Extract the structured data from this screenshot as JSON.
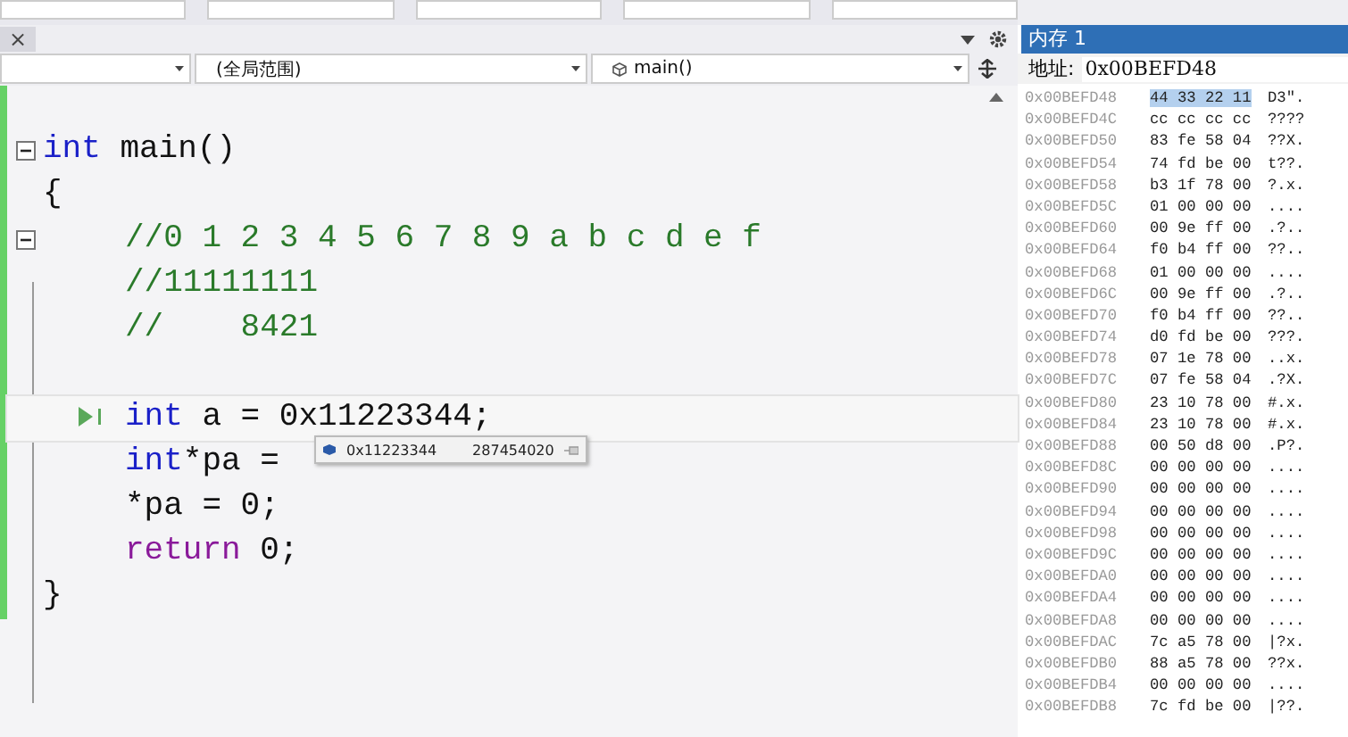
{
  "toolbar": {
    "fields": [
      {
        "kind": "field"
      },
      {
        "kind": "field"
      },
      {
        "kind": "field"
      },
      {
        "kind": "field"
      },
      {
        "kind": "field"
      }
    ]
  },
  "editor": {
    "close_glyph": "×",
    "combos": [
      {
        "icon": false
      },
      {
        "text": "(全局范围)",
        "icon": false
      },
      {
        "text": "main()",
        "icon": true
      }
    ],
    "lines": [
      {
        "fold_marker": true,
        "current": false,
        "indented": false,
        "tokens": [
          {
            "text": "int",
            "kind": "keyword"
          },
          {
            "text": " main()",
            "kind": "plain"
          }
        ]
      },
      {
        "fold_marker": false,
        "current": false,
        "indented": false,
        "tokens": [
          {
            "text": "{",
            "kind": "plain"
          }
        ]
      },
      {
        "fold_marker": true,
        "current": false,
        "indented": true,
        "tokens": [
          {
            "text": "//0 1 2 3 4 5 6 7 8 9 a b c d e f",
            "kind": "comment"
          }
        ]
      },
      {
        "fold_marker": false,
        "current": false,
        "indented": true,
        "tokens": [
          {
            "text": "//11111111",
            "kind": "comment"
          }
        ]
      },
      {
        "fold_marker": false,
        "current": false,
        "indented": true,
        "tokens": [
          {
            "text": "//    8421",
            "kind": "comment"
          }
        ]
      },
      {
        "fold_marker": false,
        "current": false
      },
      {
        "fold_marker": false,
        "current": true,
        "indented": true,
        "tokens": [
          {
            "text": "int",
            "kind": "keyword"
          },
          {
            "text": " a = 0x11223344;",
            "kind": "plain"
          }
        ]
      },
      {
        "fold_marker": false,
        "current": false,
        "indented": true,
        "tokens": [
          {
            "text": "int",
            "kind": "keyword"
          },
          {
            "text": "*pa =",
            "kind": "plain"
          }
        ]
      },
      {
        "fold_marker": false,
        "current": false,
        "indented": true,
        "tokens": [
          {
            "text": "*pa = 0;",
            "kind": "plain"
          }
        ]
      },
      {
        "fold_marker": false,
        "current": false,
        "indented": true,
        "tokens": [
          {
            "text": "return",
            "kind": "control"
          },
          {
            "text": " 0;",
            "kind": "plain"
          }
        ]
      },
      {
        "fold_marker": false,
        "current": false,
        "indented": false,
        "tokens": [
          {
            "text": "}",
            "kind": "plain"
          }
        ]
      }
    ],
    "datatip": {
      "value": "0x11223344",
      "decimal": "287454020"
    }
  },
  "memory": {
    "title": "内存 1",
    "address_label": "地址:",
    "address": "0x00BEFD48",
    "rows": [
      {
        "address": "0x00BEFD48",
        "bytes": "44 33 22 11",
        "ascii": "D3\".",
        "selected": true
      },
      {
        "address": "0x00BEFD4C",
        "bytes": "cc cc cc cc",
        "ascii": "????",
        "selected": false
      },
      {
        "address": "0x00BEFD50",
        "bytes": "83 fe 58 04",
        "ascii": "??X.",
        "selected": false
      },
      {
        "address": "0x00BEFD54",
        "bytes": "74 fd be 00",
        "ascii": "t??.",
        "selected": false
      },
      {
        "address": "0x00BEFD58",
        "bytes": "b3 1f 78 00",
        "ascii": "?.x.",
        "selected": false
      },
      {
        "address": "0x00BEFD5C",
        "bytes": "01 00 00 00",
        "ascii": "....",
        "selected": false
      },
      {
        "address": "0x00BEFD60",
        "bytes": "00 9e ff 00",
        "ascii": ".?..",
        "selected": false
      },
      {
        "address": "0x00BEFD64",
        "bytes": "f0 b4 ff 00",
        "ascii": "??..",
        "selected": false
      },
      {
        "address": "0x00BEFD68",
        "bytes": "01 00 00 00",
        "ascii": "....",
        "selected": false
      },
      {
        "address": "0x00BEFD6C",
        "bytes": "00 9e ff 00",
        "ascii": ".?..",
        "selected": false
      },
      {
        "address": "0x00BEFD70",
        "bytes": "f0 b4 ff 00",
        "ascii": "??..",
        "selected": false
      },
      {
        "address": "0x00BEFD74",
        "bytes": "d0 fd be 00",
        "ascii": "???.",
        "selected": false
      },
      {
        "address": "0x00BEFD78",
        "bytes": "07 1e 78 00",
        "ascii": "..x.",
        "selected": false
      },
      {
        "address": "0x00BEFD7C",
        "bytes": "07 fe 58 04",
        "ascii": ".?X.",
        "selected": false
      },
      {
        "address": "0x00BEFD80",
        "bytes": "23 10 78 00",
        "ascii": "#.x.",
        "selected": false
      },
      {
        "address": "0x00BEFD84",
        "bytes": "23 10 78 00",
        "ascii": "#.x.",
        "selected": false
      },
      {
        "address": "0x00BEFD88",
        "bytes": "00 50 d8 00",
        "ascii": ".P?.",
        "selected": false
      },
      {
        "address": "0x00BEFD8C",
        "bytes": "00 00 00 00",
        "ascii": "....",
        "selected": false
      },
      {
        "address": "0x00BEFD90",
        "bytes": "00 00 00 00",
        "ascii": "....",
        "selected": false
      },
      {
        "address": "0x00BEFD94",
        "bytes": "00 00 00 00",
        "ascii": "....",
        "selected": false
      },
      {
        "address": "0x00BEFD98",
        "bytes": "00 00 00 00",
        "ascii": "....",
        "selected": false
      },
      {
        "address": "0x00BEFD9C",
        "bytes": "00 00 00 00",
        "ascii": "....",
        "selected": false
      },
      {
        "address": "0x00BEFDA0",
        "bytes": "00 00 00 00",
        "ascii": "....",
        "selected": false
      },
      {
        "address": "0x00BEFDA4",
        "bytes": "00 00 00 00",
        "ascii": "....",
        "selected": false
      },
      {
        "address": "0x00BEFDA8",
        "bytes": "00 00 00 00",
        "ascii": "....",
        "selected": false
      },
      {
        "address": "0x00BEFDAC",
        "bytes": "7c a5 78 00",
        "ascii": "|?x.",
        "selected": false
      },
      {
        "address": "0x00BEFDB0",
        "bytes": "88 a5 78 00",
        "ascii": "??x.",
        "selected": false
      },
      {
        "address": "0x00BEFDB4",
        "bytes": "00 00 00 00",
        "ascii": "....",
        "selected": false
      },
      {
        "address": "0x00BEFDB8",
        "bytes": "7c fd be 00",
        "ascii": "|??.",
        "selected": false
      }
    ]
  }
}
